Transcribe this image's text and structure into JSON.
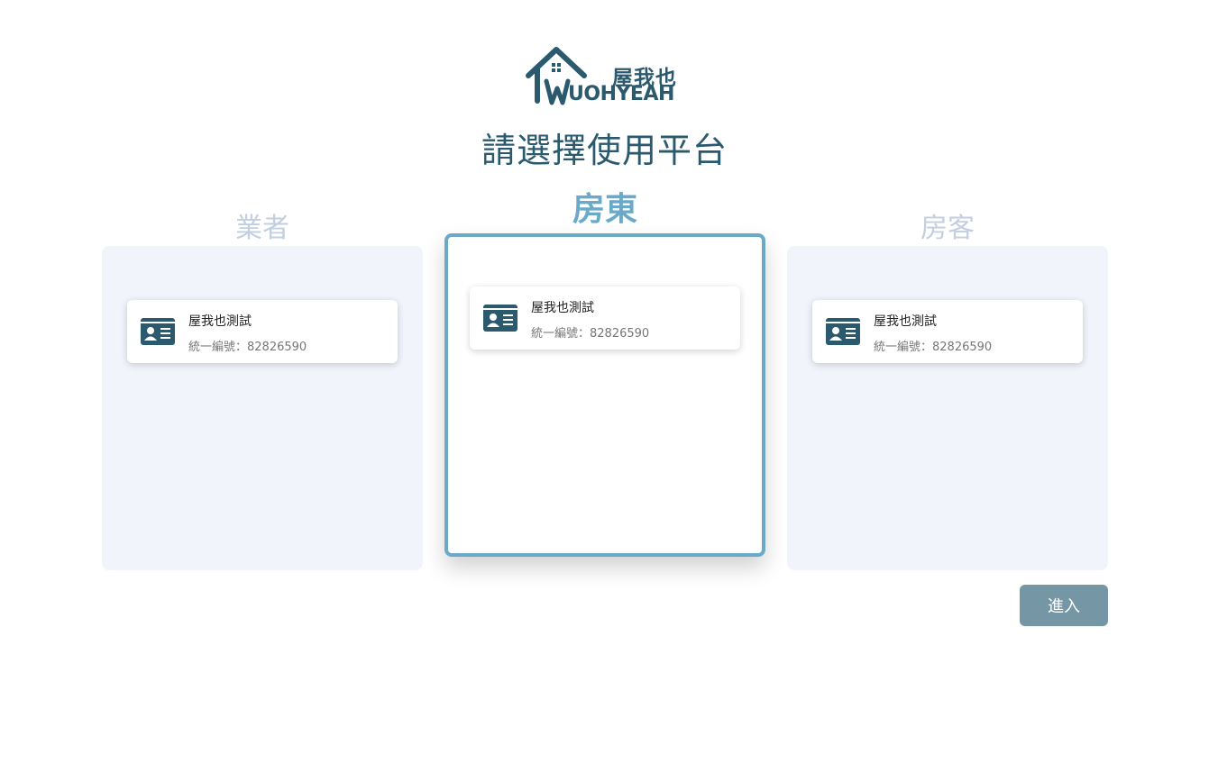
{
  "logo": {
    "cn": "屋我也",
    "en": "UOHYEAH",
    "w": "W"
  },
  "page_title": "請選擇使用平台",
  "columns": [
    {
      "title": "業者",
      "active": false,
      "card": {
        "name": "屋我也測試",
        "id_text": "統一編號：82826590",
        "icon": "id-card-icon"
      }
    },
    {
      "title": "房東",
      "active": true,
      "card": {
        "name": "屋我也測試",
        "id_text": "統一編號：82826590",
        "icon": "id-card-icon"
      }
    },
    {
      "title": "房客",
      "active": false,
      "card": {
        "name": "屋我也測試",
        "id_text": "統一編號：82826590",
        "icon": "id-card-icon"
      }
    }
  ],
  "enter_label": "進入",
  "colors": {
    "brand": "#2b5a6e",
    "accent": "#6aaac8",
    "inactive_title": "#c2cfe0",
    "panel_bg": "#f1f4fb",
    "button_bg": "#7596a5"
  }
}
